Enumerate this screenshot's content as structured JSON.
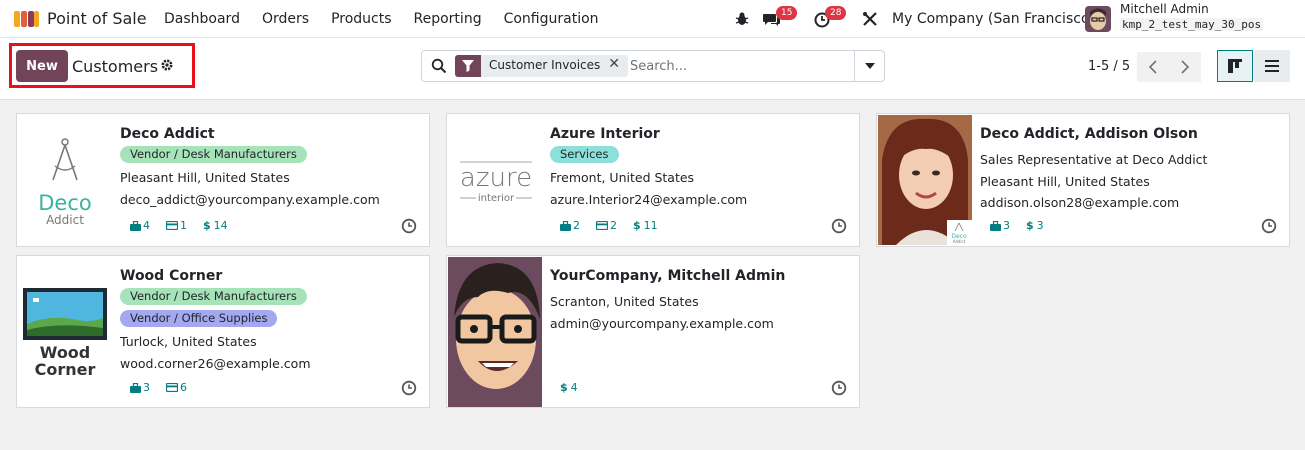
{
  "nav": {
    "app_name": "Point of Sale",
    "menu": [
      "Dashboard",
      "Orders",
      "Products",
      "Reporting",
      "Configuration"
    ],
    "messages_count": "15",
    "activities_count": "28",
    "company": "My Company (San Francisco)",
    "user_name": "Mitchell Admin",
    "db_name": "kmp_2_test_may_30_pos"
  },
  "control": {
    "new_label": "New",
    "title": "Customers",
    "facet_label": "Customer Invoices",
    "search_placeholder": "Search...",
    "pager": "1-5 / 5"
  },
  "colors": {
    "brand": "#71445a",
    "accent": "#017e84",
    "highlight": "#e8101a"
  },
  "cards": [
    {
      "name": "Deco Addict",
      "tags": [
        {
          "label": "Vendor / Desk Manufacturers",
          "color": "#a6e3b8"
        }
      ],
      "location": "Pleasant Hill, United States",
      "email": "deco_addict@yourcompany.example.com",
      "stats": {
        "opportunities": "4",
        "cards": "1",
        "money": "14"
      },
      "logo_text": [
        "Deco",
        "Addict"
      ]
    },
    {
      "name": "Azure Interior",
      "tags": [
        {
          "label": "Services",
          "color": "#8ce0d9"
        }
      ],
      "location": "Fremont, United States",
      "email": "azure.Interior24@example.com",
      "stats": {
        "opportunities": "2",
        "cards": "2",
        "money": "11"
      },
      "logo_text": [
        "azure",
        "interior"
      ]
    },
    {
      "name": "Deco Addict, Addison Olson",
      "job": "Sales Representative at Deco Addict",
      "location": "Pleasant Hill, United States",
      "email": "addison.olson28@example.com",
      "stats": {
        "opportunities": "3",
        "money": "3"
      },
      "logo_text": [
        "Deco",
        "Addict"
      ]
    },
    {
      "name": "Wood Corner",
      "tags": [
        {
          "label": "Vendor / Desk Manufacturers",
          "color": "#a6e3b8"
        },
        {
          "label": "Vendor / Office Supplies",
          "color": "#a3a8f0"
        }
      ],
      "location": "Turlock, United States",
      "email": "wood.corner26@example.com",
      "stats": {
        "opportunities": "3",
        "cards": "6"
      },
      "logo_text": [
        "Wood",
        "Corner"
      ]
    },
    {
      "name": "YourCompany, Mitchell Admin",
      "location": "Scranton, United States",
      "email": "admin@yourcompany.example.com",
      "stats": {
        "money": "4"
      }
    }
  ]
}
